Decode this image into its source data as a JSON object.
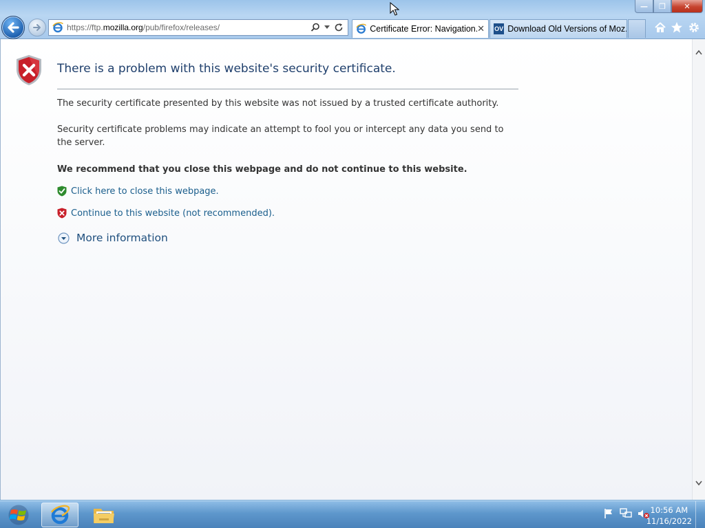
{
  "browser": {
    "url_prefix": "https://ftp.",
    "url_host": "mozilla.org",
    "url_path": "/pub/firefox/releases/",
    "tabs": [
      {
        "label": "Certificate Error: Navigation...",
        "active": true
      },
      {
        "label": "Download Old Versions of Moz...",
        "active": false
      }
    ],
    "tab_close": "✕",
    "window_controls": {
      "minimize": "—",
      "maximize": "❐",
      "close": "✕"
    }
  },
  "page": {
    "title": "There is a problem with this website's security certificate.",
    "paragraph1": "The security certificate presented by this website was not issued by a trusted certificate authority.",
    "paragraph2": "Security certificate problems may indicate an attempt to fool you or intercept any data you send to the server.",
    "recommendation": "We recommend that you close this webpage and do not continue to this website.",
    "close_link": "Click here to close this webpage.",
    "continue_link": "Continue to this website (not recommended).",
    "more_info": "More information"
  },
  "taskbar": {
    "time": "10:56 AM",
    "date": "11/16/2022"
  },
  "icons": {
    "ov_badge": "OV"
  },
  "colors": {
    "title": "#1f3f6c",
    "link": "#1a5e8c",
    "error_shield": "#c8202a",
    "ok_shield": "#2e8b2e"
  }
}
